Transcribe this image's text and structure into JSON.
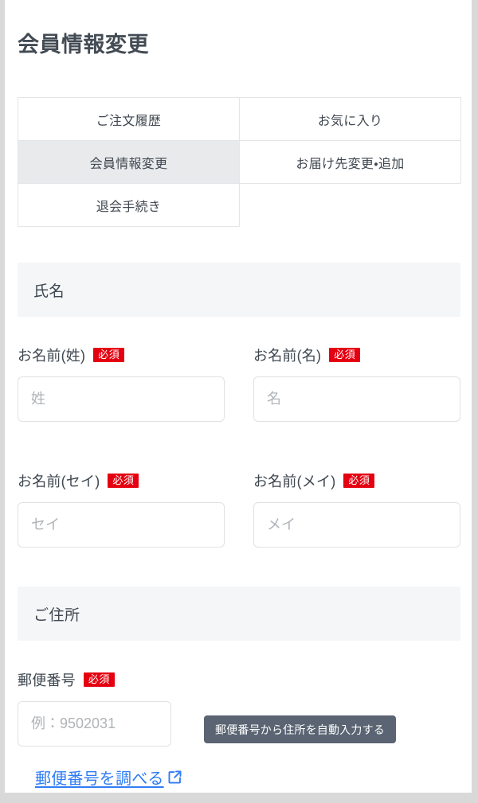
{
  "page": {
    "title": "会員情報変更"
  },
  "tabs": [
    {
      "label": "ご注文履歴",
      "active": false
    },
    {
      "label": "お気に入り",
      "active": false
    },
    {
      "label": "会員情報変更",
      "active": true
    },
    {
      "label": "お届け先変更・追加",
      "active": false
    },
    {
      "label": "退会手続き",
      "active": false
    }
  ],
  "sections": {
    "name": {
      "heading": "氏名",
      "fields": {
        "last_name": {
          "label": "お名前(姓)",
          "required_badge": "必須",
          "placeholder": "姓",
          "value": ""
        },
        "first_name": {
          "label": "お名前(名)",
          "required_badge": "必須",
          "placeholder": "名",
          "value": ""
        },
        "last_name_kana": {
          "label": "お名前(セイ)",
          "required_badge": "必須",
          "placeholder": "セイ",
          "value": ""
        },
        "first_name_kana": {
          "label": "お名前(メイ)",
          "required_badge": "必須",
          "placeholder": "メイ",
          "value": ""
        }
      }
    },
    "address": {
      "heading": "ご住所",
      "fields": {
        "postal_code": {
          "label": "郵便番号",
          "required_badge": "必須",
          "placeholder": "例：9502031",
          "value": ""
        }
      },
      "autofill_button_label": "郵便番号から住所を自動入力する",
      "lookup_link_label": "郵便番号を調べる",
      "lookup_link_icon": "external-link-icon"
    }
  },
  "colors": {
    "required_badge_bg": "#e50011",
    "autofill_button_bg": "#5a6472",
    "link": "#2f7cf6",
    "section_header_bg": "#f4f6f8",
    "active_tab_bg": "#e9eaec",
    "text": "#3f4750"
  }
}
